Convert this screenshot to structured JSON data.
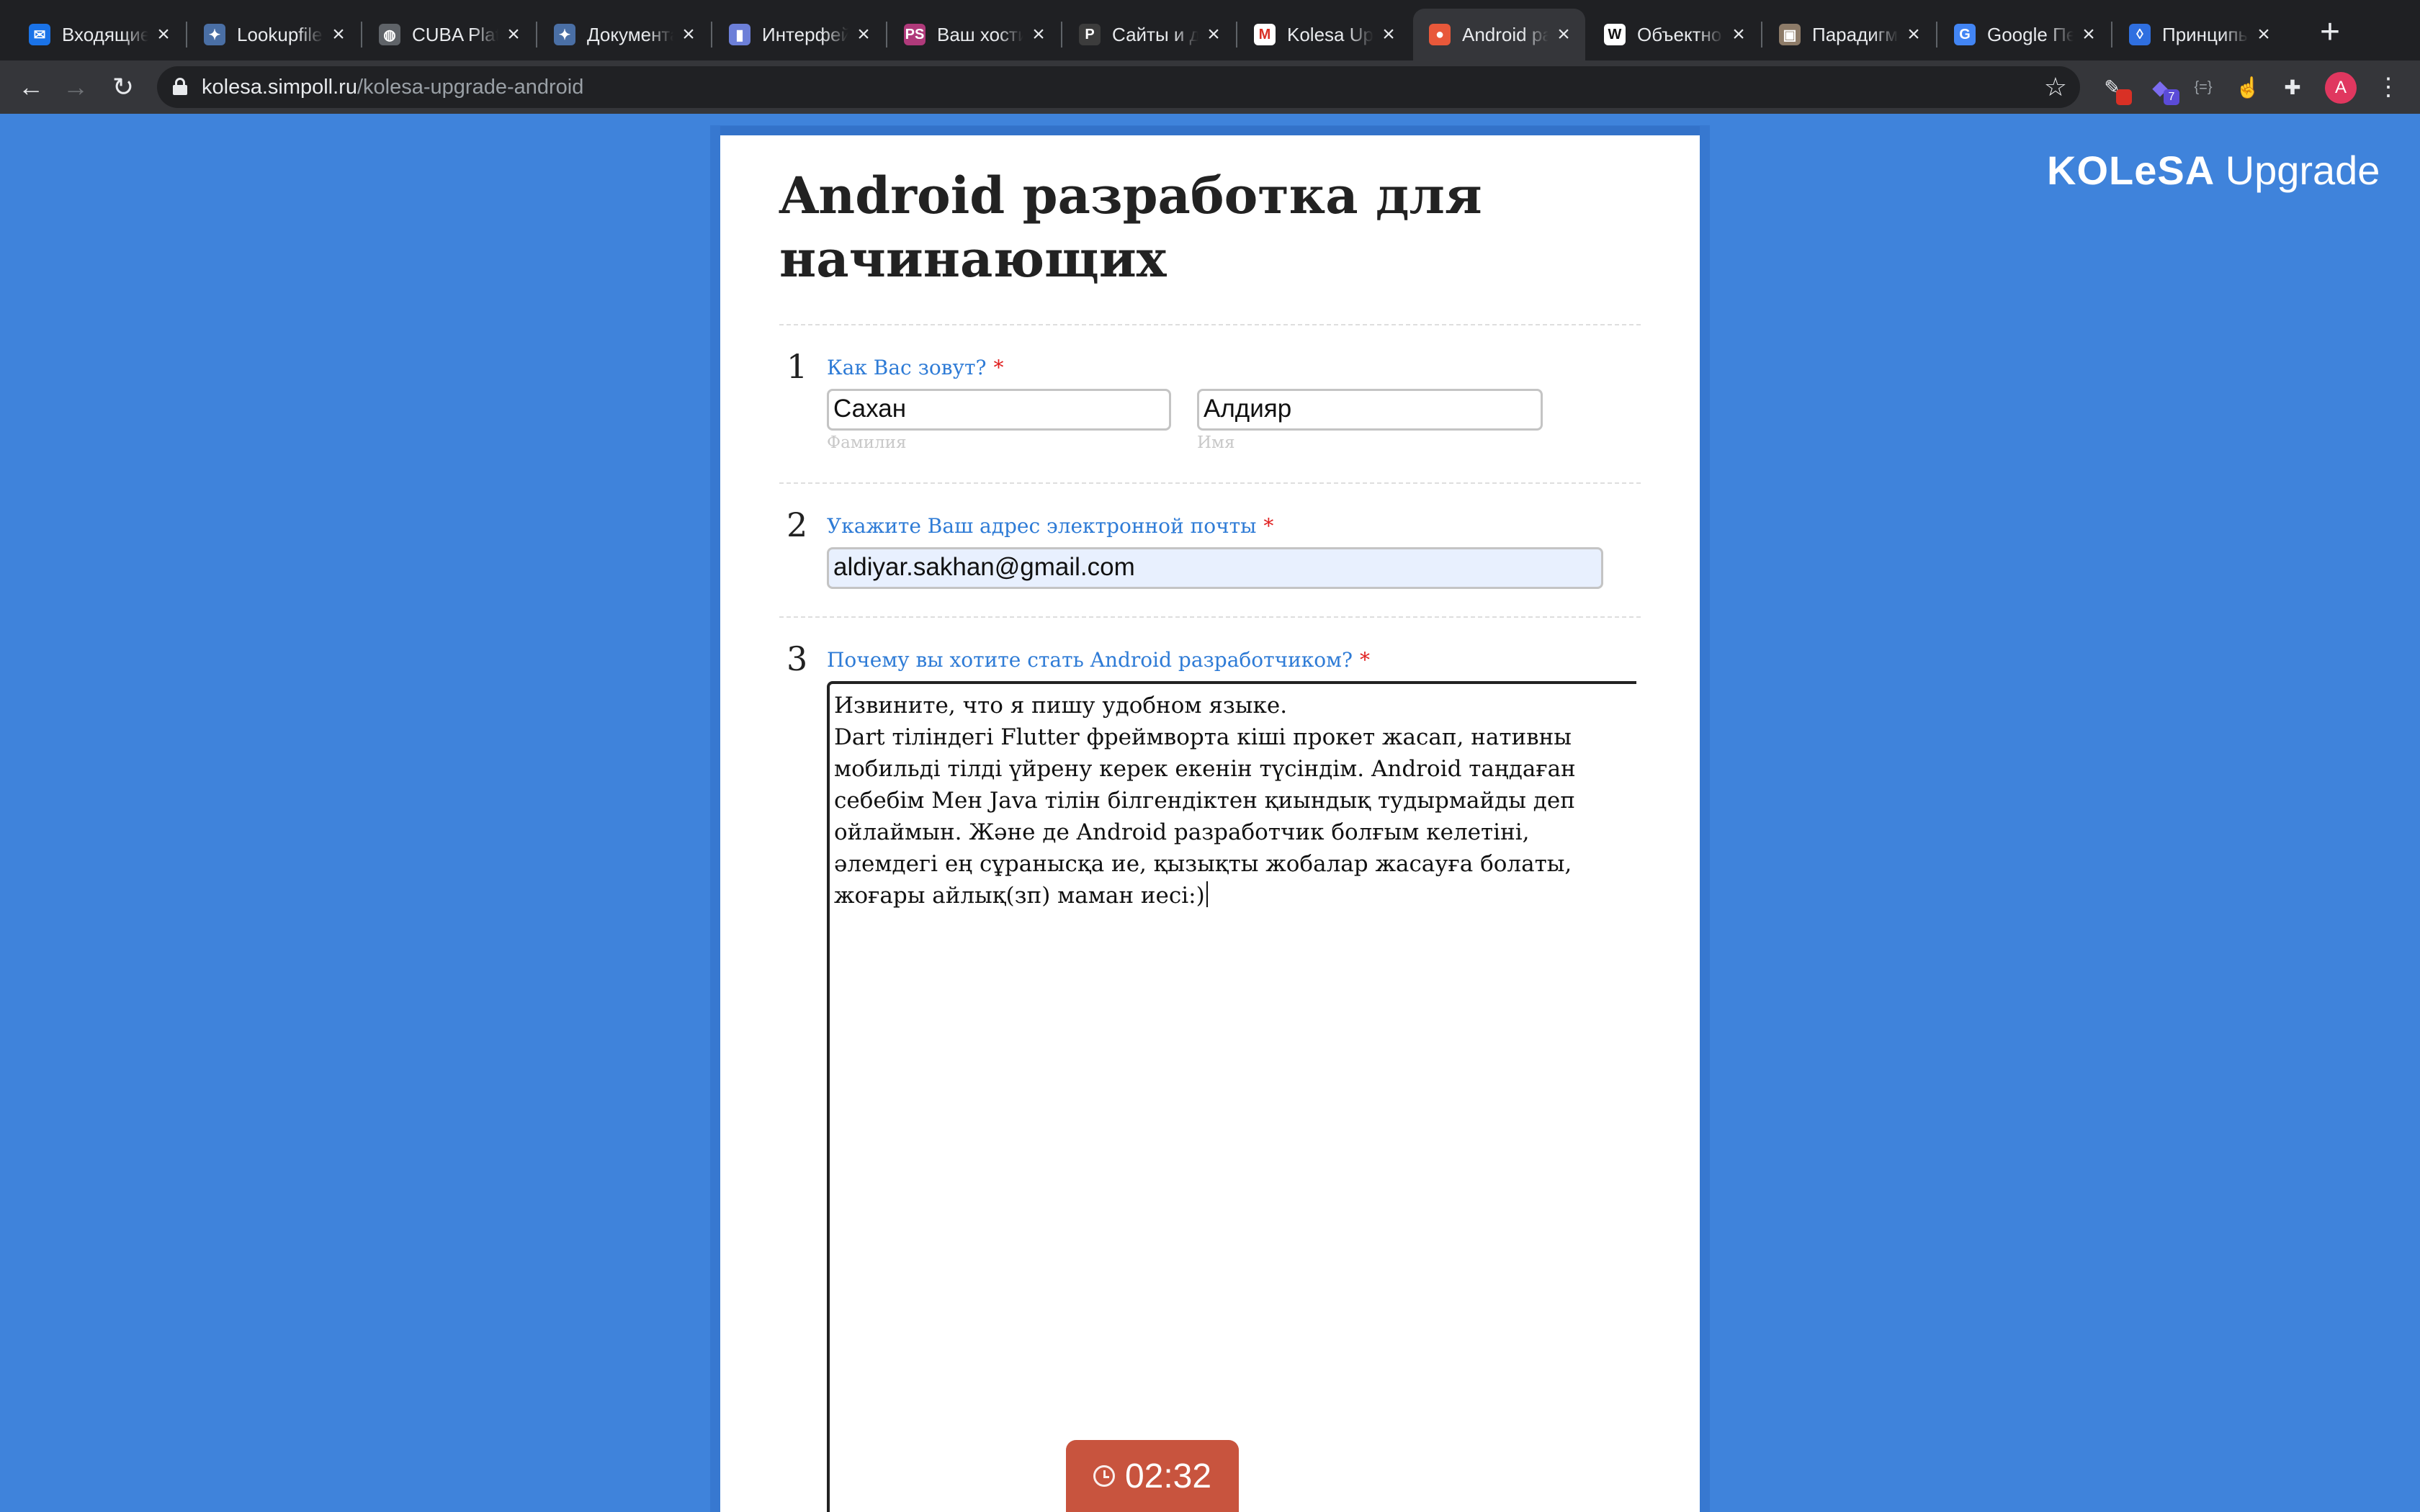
{
  "browser": {
    "tabs": [
      {
        "title": "Входящие",
        "favicon": "mail-icon",
        "color": "#1a73e8",
        "glyph": "✉"
      },
      {
        "title": "Lookupfile",
        "favicon": "gear-icon",
        "color": "#4a6fa5",
        "glyph": "✦"
      },
      {
        "title": "CUBA Platform",
        "favicon": "globe-icon",
        "color": "#5f6368",
        "glyph": "◍"
      },
      {
        "title": "Документация",
        "favicon": "gear-icon",
        "color": "#4a6fa5",
        "glyph": "✦"
      },
      {
        "title": "Интерфейсы",
        "favicon": "book-icon",
        "color": "#6c7fd8",
        "glyph": "▮"
      },
      {
        "title": "Ваш хостинг",
        "favicon": "ps-icon",
        "color": "#b03a7b",
        "glyph": "PS"
      },
      {
        "title": "Сайты и домены",
        "favicon": "p-icon",
        "color": "#3c3c3c",
        "glyph": "P"
      },
      {
        "title": "Kolesa Upgrade",
        "favicon": "gmail-icon",
        "color": "#ffffff",
        "glyph": "M"
      },
      {
        "title": "Android разработка",
        "favicon": "simpoll-icon",
        "color": "#e8583a",
        "glyph": "●",
        "active": true
      },
      {
        "title": "Объектно",
        "favicon": "wikipedia-icon",
        "color": "#ffffff",
        "glyph": "W"
      },
      {
        "title": "Парадигмы",
        "favicon": "image-icon",
        "color": "#8d7b68",
        "glyph": "▣"
      },
      {
        "title": "Google Переводчик",
        "favicon": "translate-icon",
        "color": "#4285f4",
        "glyph": "G"
      },
      {
        "title": "Принципы",
        "favicon": "diamond-icon",
        "color": "#2f6fe0",
        "glyph": "◊"
      }
    ],
    "url_host": "kolesa.simpoll.ru",
    "url_path": "/kolesa-upgrade-android",
    "extensions_badge_1": "",
    "extensions_badge_2": "7",
    "avatar_letter": "A"
  },
  "brand": {
    "name": "KOLeSA",
    "suffix": "Upgrade"
  },
  "form": {
    "title": "Android разработка для начинающих",
    "required_mark": "*",
    "q1": {
      "number": "1",
      "label": "Как Вас зовут?",
      "last_name_value": "Сахан",
      "last_name_caption": "Фамилия",
      "first_name_value": "Алдияр",
      "first_name_caption": "Имя"
    },
    "q2": {
      "number": "2",
      "label": "Укажите Ваш адрес электронной почты",
      "email_value": "aldiyar.sakhan@gmail.com"
    },
    "q3": {
      "number": "3",
      "label": "Почему вы хотите стать Android разработчиком?",
      "answer_lines": [
        "Извините, что я пишу удобном языке.",
        "Dart тіліндегі Flutter фреймворта кіші прокет жасап, нативны",
        "мобильді тілді үйрену керек екенін түсіндім. Android таңдаған",
        "себебім Мен Java тілін білгендіктен қиындық тудырмайды деп",
        "ойлаймын. Және де Android разработчик болғым келетіні,",
        "әлемдегі ең сұранысқа ие, қызықты жобалар жасауға болаты,",
        "жоғары айлық(зп) маман иесі:)"
      ]
    },
    "timer": "02:32"
  }
}
